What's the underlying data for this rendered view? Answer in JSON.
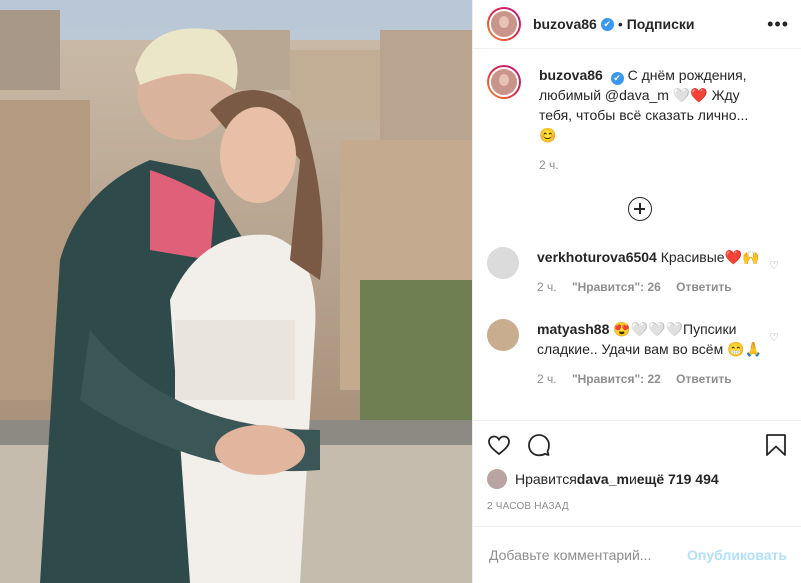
{
  "header": {
    "username": "buzova86",
    "verified_glyph": "✔",
    "separator": "•",
    "follow_label": "Подписки",
    "more_glyph": "•••"
  },
  "caption": {
    "username": "buzova86",
    "text": "С днём рождения, любимый @dava_m 🤍❤️ Жду тебя, чтобы всё сказать лично...😊",
    "time": "2 ч."
  },
  "comments": [
    {
      "username": "verkhoturova6504",
      "text": "Красивые❤️🙌",
      "time": "2 ч.",
      "likes": "\"Нравится\": 26",
      "reply": "Ответить",
      "avatar_color": "#dbdbdb"
    },
    {
      "username": "matyash88",
      "text": "😍🤍🤍🤍Пупсики сладкие.. Удачи вам во всём 😁🙏",
      "time": "2 ч.",
      "likes": "\"Нравится\": 22",
      "reply": "Ответить",
      "avatar_color": "#c9ad8f"
    }
  ],
  "likes": {
    "prefix": "Нравится ",
    "user": "dava_m",
    "middle": " и ",
    "count": "ещё 719 494"
  },
  "timestamp": "2 часов назад",
  "add_comment": {
    "placeholder": "Добавьте комментарий...",
    "publish_label": "Опубликовать"
  },
  "colors": {
    "verified": "#3897f0",
    "publish": "#b2dffc",
    "muted": "#8e8e8e"
  }
}
